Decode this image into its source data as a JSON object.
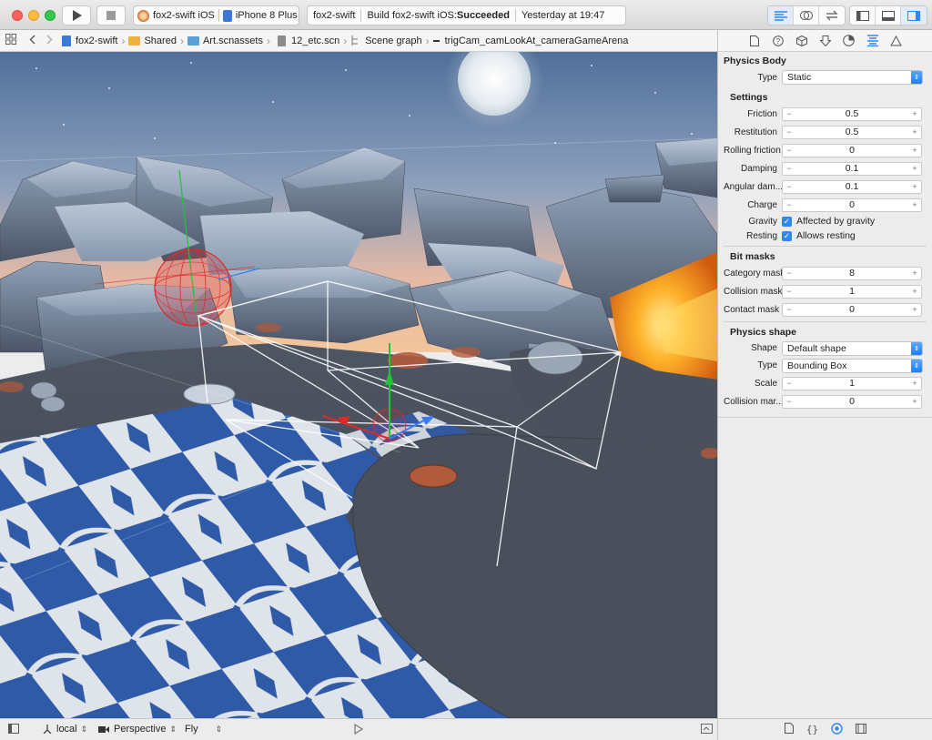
{
  "toolbar": {
    "scheme_target": "fox2-swift iOS",
    "scheme_device": "iPhone 8 Plus",
    "activity_project": "fox2-swift",
    "activity_status_prefix": "Build fox2-swift iOS: ",
    "activity_status_result": "Succeeded",
    "activity_time": "Yesterday at 19:47"
  },
  "jumpbar": {
    "items": [
      "fox2-swift",
      "Shared",
      "Art.scnassets",
      "12_etc.scn",
      "Scene graph",
      "trigCam_camLookAt_cameraGameArena"
    ]
  },
  "bottombar": {
    "coord_space": "local",
    "camera": "Perspective",
    "nav_mode": "Fly"
  },
  "inspector": {
    "physics_body": {
      "title": "Physics Body",
      "type_label": "Type",
      "type_value": "Static"
    },
    "settings": {
      "title": "Settings",
      "rows": [
        {
          "label": "Friction",
          "value": "0.5"
        },
        {
          "label": "Restitution",
          "value": "0.5"
        },
        {
          "label": "Rolling friction",
          "value": "0"
        },
        {
          "label": "Damping",
          "value": "0.1"
        },
        {
          "label": "Angular dam...",
          "value": "0.1"
        },
        {
          "label": "Charge",
          "value": "0"
        }
      ],
      "gravity_label": "Gravity",
      "gravity_text": "Affected by gravity",
      "resting_label": "Resting",
      "resting_text": "Allows resting"
    },
    "bit_masks": {
      "title": "Bit masks",
      "rows": [
        {
          "label": "Category mask",
          "value": "8"
        },
        {
          "label": "Collision mask",
          "value": "1"
        },
        {
          "label": "Contact mask",
          "value": "0"
        }
      ]
    },
    "physics_shape": {
      "title": "Physics shape",
      "shape_label": "Shape",
      "shape_value": "Default shape",
      "type_label": "Type",
      "type_value": "Bounding Box",
      "scale_label": "Scale",
      "scale_value": "1",
      "margin_label": "Collision mar...",
      "margin_value": "0"
    }
  },
  "colors": {
    "accent": "#2f87f6",
    "selection_red": "#e02a2a",
    "axis_green": "#22c43a",
    "axis_blue": "#3a7bf0"
  }
}
